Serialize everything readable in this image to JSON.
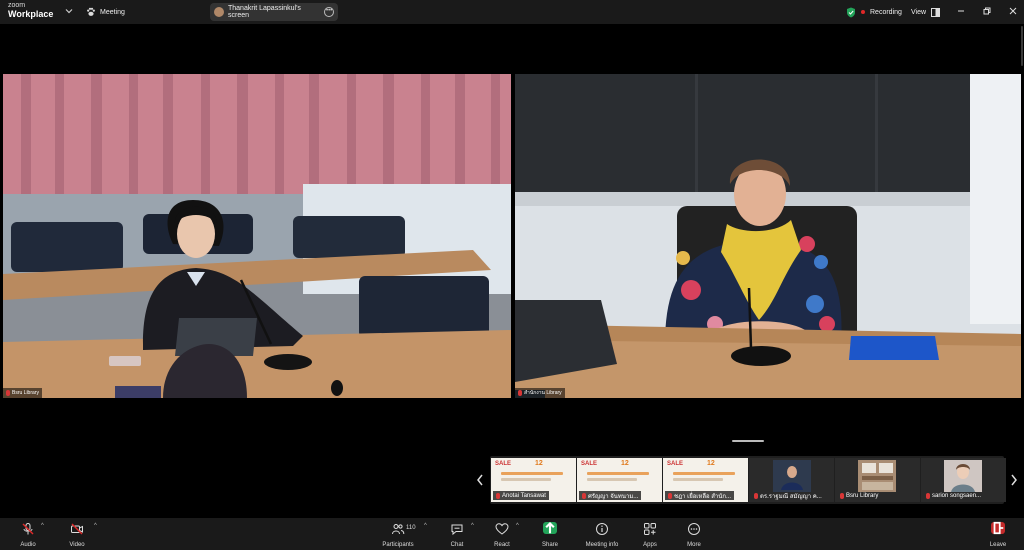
{
  "app": {
    "brand_small": "zoom",
    "brand_name": "Workplace",
    "meeting_label": "Meeting",
    "share_label": "Thanakrit Lapassinkul's screen",
    "recording_label": "Recording",
    "view_label": "View",
    "accent_green": "#23a45a",
    "accent_red": "#e02828"
  },
  "videos": [
    {
      "name": "Bsru Library"
    },
    {
      "name": "สำนักงาน Library"
    }
  ],
  "thumbnails": [
    {
      "kind": "slide",
      "name": "Anotai Tansawat",
      "slide_title": "SALE",
      "slide_number": "12"
    },
    {
      "kind": "slide",
      "name": "ศรัญญา จันทนาม...",
      "slide_title": "SALE",
      "slide_number": "12"
    },
    {
      "kind": "slide",
      "name": "ชฎา เยื่อเหลือ สำนัก...",
      "slide_title": "SALE",
      "slide_number": "12"
    },
    {
      "kind": "camera",
      "name": "ดร.ราฐมณี สมัญญา ค..."
    },
    {
      "kind": "camera",
      "name": "Bsru Library"
    },
    {
      "kind": "camera",
      "name": "sarion songsaen..."
    }
  ],
  "toolbar": {
    "audio": "Audio",
    "video": "Video",
    "participants": "Participants",
    "participant_count": "110",
    "chat": "Chat",
    "react": "React",
    "share": "Share",
    "meeting_info": "Meeting info",
    "apps": "Apps",
    "more": "More",
    "leave": "Leave"
  }
}
